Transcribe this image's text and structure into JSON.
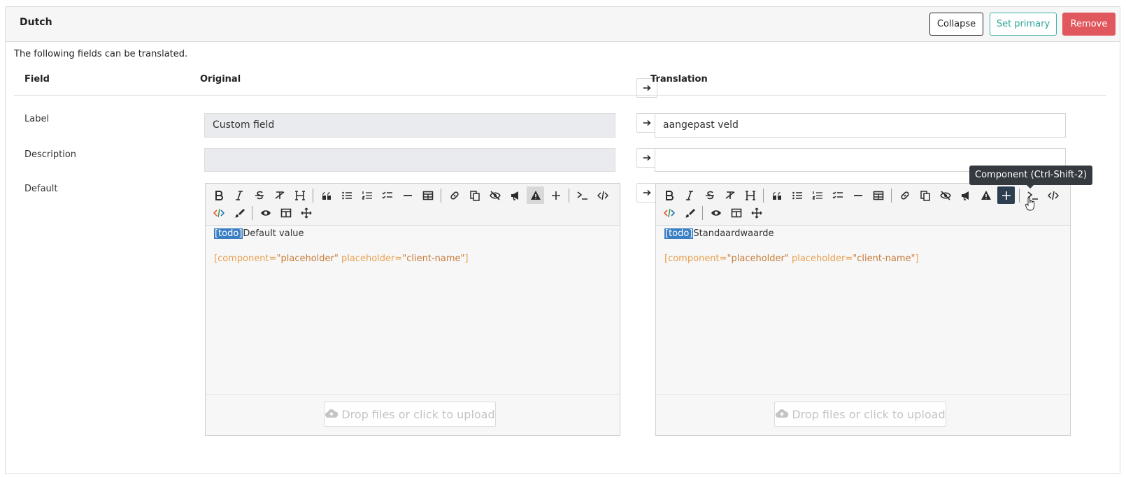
{
  "header": {
    "title": "Dutch",
    "collapse_label": "Collapse",
    "set_primary_label": "Set primary",
    "remove_label": "Remove"
  },
  "intro": "The following fields can be translated.",
  "columns": {
    "field": "Field",
    "original": "Original",
    "translation": "Translation"
  },
  "rows": [
    {
      "label": "Label",
      "original": "Custom field",
      "translation": "aangepast veld"
    },
    {
      "label": "Description",
      "original": "",
      "translation": ""
    },
    {
      "label": "Default"
    }
  ],
  "editor_original": {
    "todo_tag": "[todo]",
    "text": "Default value",
    "code_open": "[",
    "code_attr1": "component=",
    "code_val1": "\"placeholder\"",
    "code_attr2": " placeholder=",
    "code_val2": "\"client-name\"",
    "code_close": "]",
    "upload_label": "Drop files or click to upload"
  },
  "editor_translation": {
    "todo_tag": "[todo]",
    "text": "Standaardwaarde",
    "code_open": "[",
    "code_attr1": "component=",
    "code_val1": "\"placeholder\"",
    "code_attr2": " placeholder=",
    "code_val2": "\"client-name\"",
    "code_close": "]",
    "upload_label": "Drop files or click to upload"
  },
  "tooltip": "Component (Ctrl-Shift-2)",
  "toolbar_icons_row1": [
    "bold-icon",
    "italic-icon",
    "strikethrough-icon",
    "clear-format-icon",
    "heading-icon",
    "quote-icon",
    "unordered-list-icon",
    "ordered-list-icon",
    "checklist-icon",
    "horizontal-rule-icon",
    "table-icon",
    "link-icon",
    "copy-icon",
    "hide-icon",
    "announcement-icon",
    "warning-icon",
    "component-icon",
    "terminal-icon",
    "code-icon"
  ],
  "toolbar_icons_row2": [
    "code-color-icon",
    "brush-icon",
    "preview-icon",
    "side-by-side-icon",
    "fullscreen-icon"
  ],
  "colors": {
    "accent": "#2aa597",
    "danger": "#e0575e",
    "todo_highlight": "#3a7fc4",
    "code_text": "#e8a050",
    "tooltip_bg": "#343a40"
  }
}
